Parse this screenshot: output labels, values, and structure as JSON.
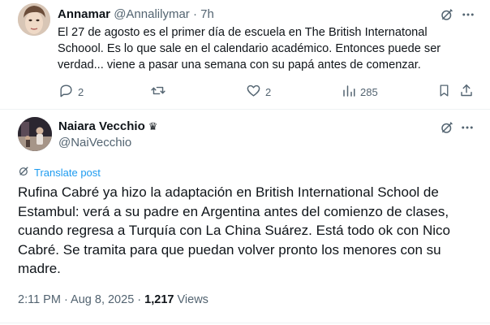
{
  "reply": {
    "name": "Annamar",
    "handle": "@Annalilymar",
    "separator": "·",
    "time": "7h",
    "lines": [
      "El 27 de agosto es el primer día de escuela en The British Internatonal",
      "Schoool.  Es lo que sale en el calendario académico. Entonces puede ser",
      "verdad... viene a pasar una semana con su papá antes de comenzar."
    ],
    "actions": {
      "replies": "2",
      "retweets": "",
      "likes": "2",
      "views": "285"
    },
    "more_label": "···"
  },
  "main": {
    "name": "Naiara Vecchio",
    "name_badge": "♛",
    "handle": "@NaiVecchio",
    "translate_label": "Translate post",
    "lines": [
      "Rufina Cabré ya hizo la adaptación en British International School de",
      "Estambul: verá a su padre en Argentina antes del comienzo de clases,",
      "cuando regresa a Turquía con La China Suárez. Está todo ok con Nico",
      "Cabré. Se tramita para que puedan volver pronto los menores con su",
      "madre."
    ],
    "time": "2:11 PM",
    "separator": "·",
    "date": "Aug 8, 2025",
    "views_count": "1,217",
    "views_label": "Views",
    "more_label": "···"
  },
  "icons": {
    "reply": "reply-icon",
    "retweet": "retweet-icon",
    "like": "heart-icon",
    "views": "views-chart-icon",
    "bookmark": "bookmark-icon",
    "share": "share-icon",
    "grok": "grok-icon",
    "more": "more-icon",
    "translate": "globe-icon"
  },
  "colors": {
    "text": "#0f1419",
    "secondary": "#536471",
    "link": "#1d9bf0",
    "divider": "#eff3f4"
  }
}
